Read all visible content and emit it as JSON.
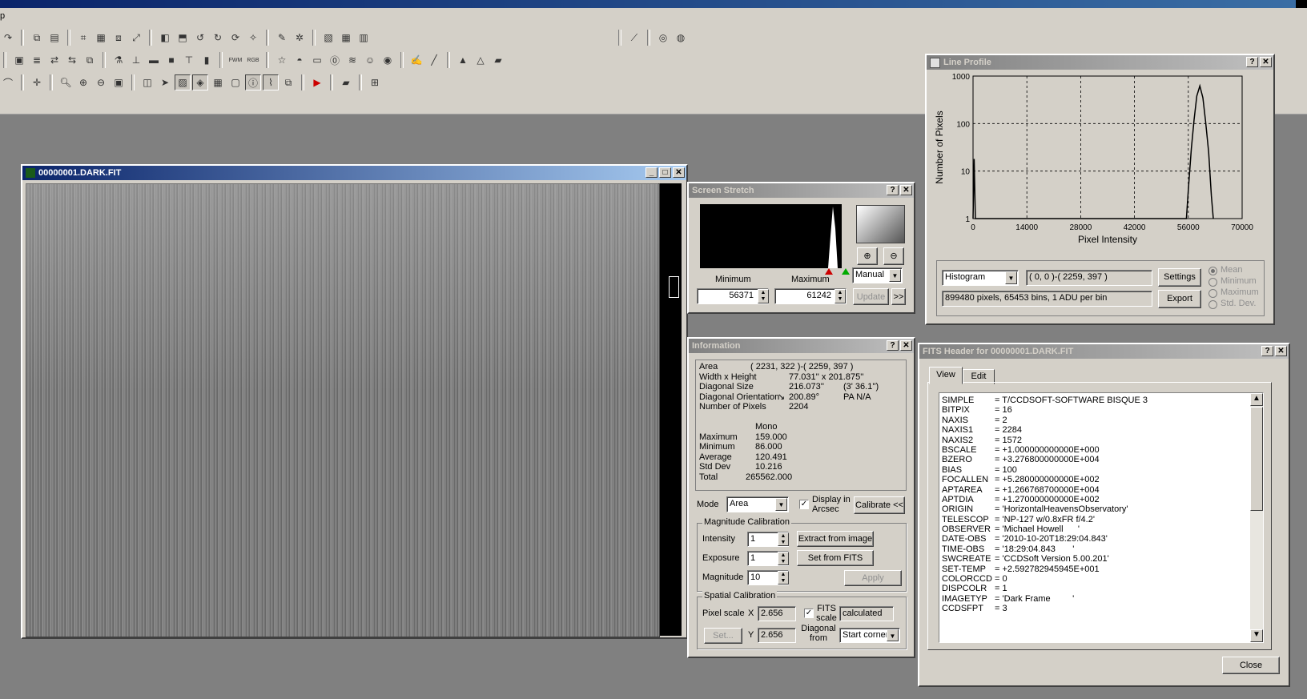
{
  "menu_fragment": "p",
  "image_window": {
    "title": "00000001.DARK.FIT"
  },
  "screen_stretch": {
    "title": "Screen Stretch",
    "minimum_label": "Minimum",
    "maximum_label": "Maximum",
    "minimum_value": "56371",
    "maximum_value": "61242",
    "mode_value": "Manual",
    "update_label": "Update",
    "more_label": ">>"
  },
  "information": {
    "title": "Information",
    "rows": [
      {
        "k": "Area",
        "v": "( 2231, 322 )-( 2259, 397 )",
        "v2": ""
      },
      {
        "k": "Width x Height",
        "v": "77.031'' x 201.875''",
        "v2": ""
      },
      {
        "k": "Diagonal Size",
        "v": "216.073''",
        "v2": "(3' 36.1'')"
      },
      {
        "k": "Diagonal Orientation",
        "v": "200.89°",
        "v2": "PA   N/A"
      },
      {
        "k": "Number of Pixels",
        "v": "2204",
        "v2": ""
      }
    ],
    "stats_header": "Mono",
    "stats": [
      {
        "k": "Maximum",
        "v": "159.000"
      },
      {
        "k": "Minimum",
        "v": "86.000"
      },
      {
        "k": "Average",
        "v": "120.491"
      },
      {
        "k": "Std Dev",
        "v": "10.216"
      },
      {
        "k": "Total",
        "v": "265562.000"
      }
    ],
    "mode_label": "Mode",
    "mode_value": "Area",
    "display_arcsec_label": "Display in Arcsec",
    "calibrate_label": "Calibrate <<",
    "mag_cal": {
      "title": "Magnitude Calibration",
      "intensity_label": "Intensity",
      "intensity_value": "1",
      "exposure_label": "Exposure",
      "exposure_value": "1",
      "magnitude_label": "Magnitude",
      "magnitude_value": "10",
      "extract_label": "Extract from image",
      "setfits_label": "Set from FITS",
      "apply_label": "Apply"
    },
    "spatial_cal": {
      "title": "Spatial Calibration",
      "pixel_scale_label": "Pixel scale",
      "x_label": "X",
      "x_value": "2.656",
      "y_label": "Y",
      "y_value": "2.656",
      "set_label": "Set...",
      "fits_scale_label": "FITS scale",
      "calculated_value": "calculated",
      "diag_from_label": "Diagonal from",
      "start_corner_value": "Start corner"
    }
  },
  "line_profile": {
    "title": "Line Profile",
    "histogram_value": "Histogram",
    "coords_value": "( 0, 0 )-( 2259, 397 )",
    "settings_label": "Settings",
    "export_label": "Export",
    "status_value": "899480 pixels, 65453 bins, 1 ADU per bin",
    "radio_labels": [
      "Mean",
      "Minimum",
      "Maximum",
      "Std. Dev."
    ]
  },
  "chart_data": {
    "type": "line",
    "xlabel": "Pixel Intensity",
    "ylabel": "Number of Pixels",
    "x_ticks": [
      "0",
      "14000",
      "28000",
      "42000",
      "56000",
      "70000"
    ],
    "y_ticks": [
      "1",
      "10",
      "100",
      "1000"
    ],
    "xlim": [
      0,
      70000
    ],
    "ylim": [
      1,
      1000
    ],
    "y_scale": "log",
    "grid": true,
    "series": [
      {
        "x": [
          0,
          300,
          600,
          55500,
          56000,
          56800,
          57500,
          58200,
          59000,
          59800,
          60500,
          61300,
          62000,
          62500
        ],
        "y": [
          1,
          18,
          1,
          1,
          4,
          30,
          120,
          380,
          620,
          350,
          110,
          25,
          3,
          1
        ]
      }
    ]
  },
  "fits_header": {
    "title": "FITS Header for 00000001.DARK.FIT",
    "tab_view": "View",
    "tab_edit": "Edit",
    "close_label": "Close",
    "lines": [
      {
        "k": "SIMPLE",
        "v": "= T/CCDSOFT-SOFTWARE BISQUE 3"
      },
      {
        "k": "BITPIX",
        "v": "= 16"
      },
      {
        "k": "NAXIS",
        "v": "= 2"
      },
      {
        "k": "NAXIS1",
        "v": "= 2284"
      },
      {
        "k": "NAXIS2",
        "v": "= 1572"
      },
      {
        "k": "BSCALE",
        "v": "= +1.000000000000E+000"
      },
      {
        "k": "BZERO",
        "v": "= +3.276800000000E+004"
      },
      {
        "k": "BIAS",
        "v": "= 100"
      },
      {
        "k": "FOCALLEN",
        "v": "= +5.280000000000E+002"
      },
      {
        "k": "APTAREA",
        "v": "= +1.266768700000E+004"
      },
      {
        "k": "APTDIA",
        "v": "= +1.270000000000E+002"
      },
      {
        "k": "ORIGIN",
        "v": "= 'HorizontalHeavensObservatory'"
      },
      {
        "k": "TELESCOP",
        "v": "= 'NP-127 w/0.8xFR f/4.2'"
      },
      {
        "k": "OBSERVER",
        "v": "= 'Michael Howell      '"
      },
      {
        "k": "DATE-OBS",
        "v": "= '2010-10-20T18:29:04.843'"
      },
      {
        "k": "TIME-OBS",
        "v": "= '18:29:04.843       '"
      },
      {
        "k": "SWCREATE",
        "v": "= 'CCDSoft Version 5.00.201'"
      },
      {
        "k": "SET-TEMP",
        "v": "= +2.592782945945E+001"
      },
      {
        "k": "COLORCCD",
        "v": "= 0"
      },
      {
        "k": "DISPCOLR",
        "v": "= 1"
      },
      {
        "k": "IMAGETYP",
        "v": "= 'Dark Frame         '"
      },
      {
        "k": "CCDSFPT",
        "v": "= 3"
      }
    ]
  }
}
